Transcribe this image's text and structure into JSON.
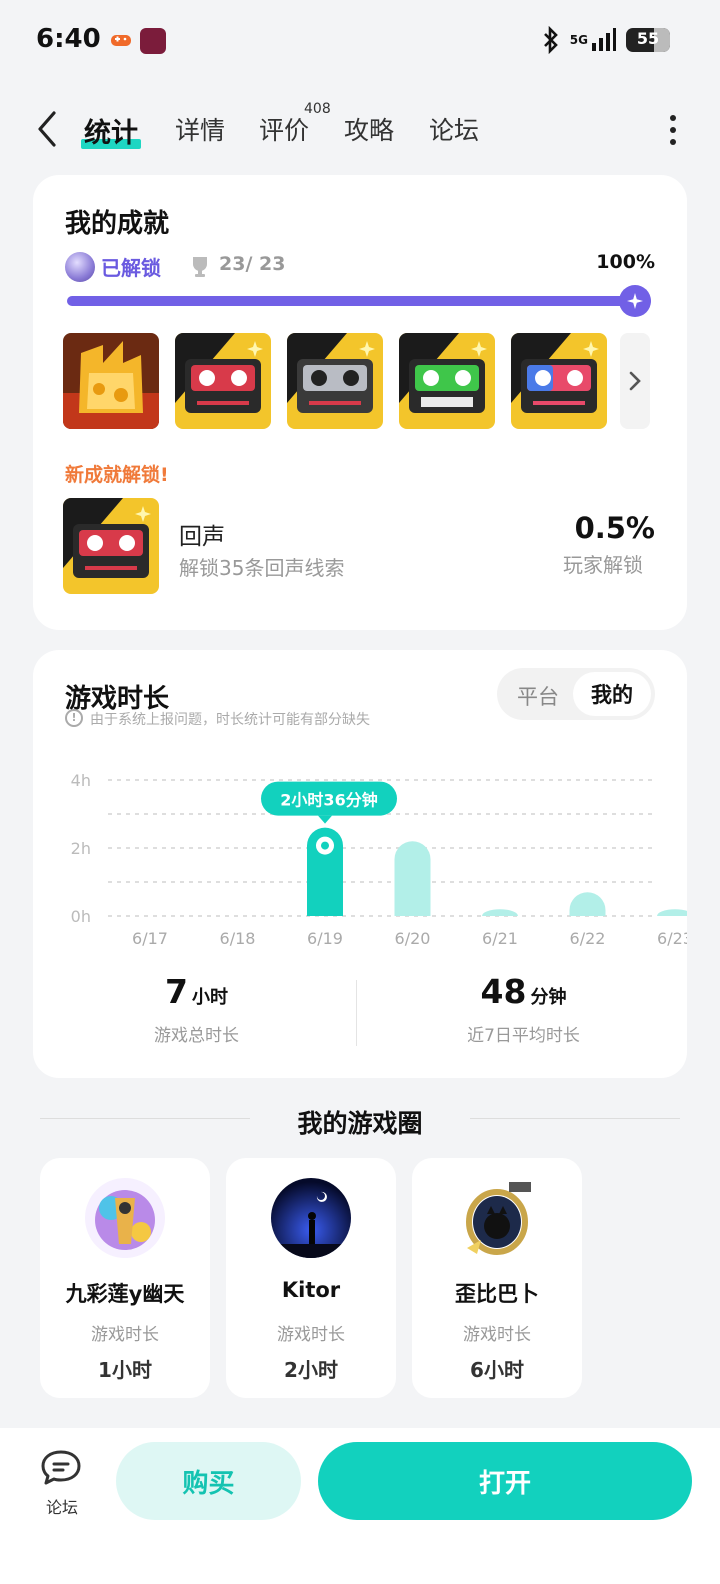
{
  "status_bar": {
    "time": "6:40",
    "network": "5G",
    "battery": "55"
  },
  "tabs": [
    {
      "label": "统计",
      "active": true
    },
    {
      "label": "详情"
    },
    {
      "label": "评价",
      "badge": "408"
    },
    {
      "label": "攻略"
    },
    {
      "label": "论坛"
    }
  ],
  "achievements": {
    "title": "我的成就",
    "unlocked_label": "已解锁",
    "count": "23/ 23",
    "percent": "100%",
    "progress": 1.0,
    "badges": [
      "gold-crown-badge",
      "cassette-red-badge",
      "cassette-silver-badge",
      "cassette-green-badge",
      "cassette-pink-badge"
    ],
    "new_title": "新成就解锁!",
    "new_name": "回声",
    "new_desc": "解锁35条回声线索",
    "new_rate": "0.5%",
    "new_rate_label": "玩家解锁"
  },
  "playtime": {
    "title": "游戏时长",
    "seg_platform": "平台",
    "seg_mine": "我的",
    "notice": "由于系统上报问题，时长统计可能有部分缺失",
    "total_value": "7",
    "total_unit": "小时",
    "total_label": "游戏总时长",
    "avg_value": "48",
    "avg_unit": "分钟",
    "avg_label": "近7日平均时长"
  },
  "chart_data": {
    "type": "bar",
    "categories": [
      "6/17",
      "6/18",
      "6/19",
      "6/20",
      "6/21",
      "6/22",
      "6/23"
    ],
    "values": [
      0,
      0,
      2.6,
      2.2,
      0.2,
      0.7,
      0.2
    ],
    "y_ticks": [
      "4h",
      "2h",
      "0h"
    ],
    "ylim": [
      0,
      4
    ],
    "highlight_index": 2,
    "highlight_label": "2小时36分钟",
    "grid": true,
    "colors": {
      "highlight": "#12d1be",
      "normal": "#b2efe8",
      "tooltip": "#12d1be"
    }
  },
  "game_circle": {
    "title": "我的游戏圈",
    "friends": [
      {
        "name": "九彩莲y幽天",
        "label": "游戏时长",
        "time": "1小时"
      },
      {
        "name": "Kitor",
        "label": "游戏时长",
        "time": "2小时"
      },
      {
        "name": "歪比巴卜",
        "label": "游戏时长",
        "time": "6小时"
      }
    ]
  },
  "bottom_bar": {
    "forum": "论坛",
    "buy": "购买",
    "open": "打开"
  },
  "colors": {
    "accent": "#12d1be",
    "purple": "#7160e6",
    "orange": "#f07a3a"
  }
}
